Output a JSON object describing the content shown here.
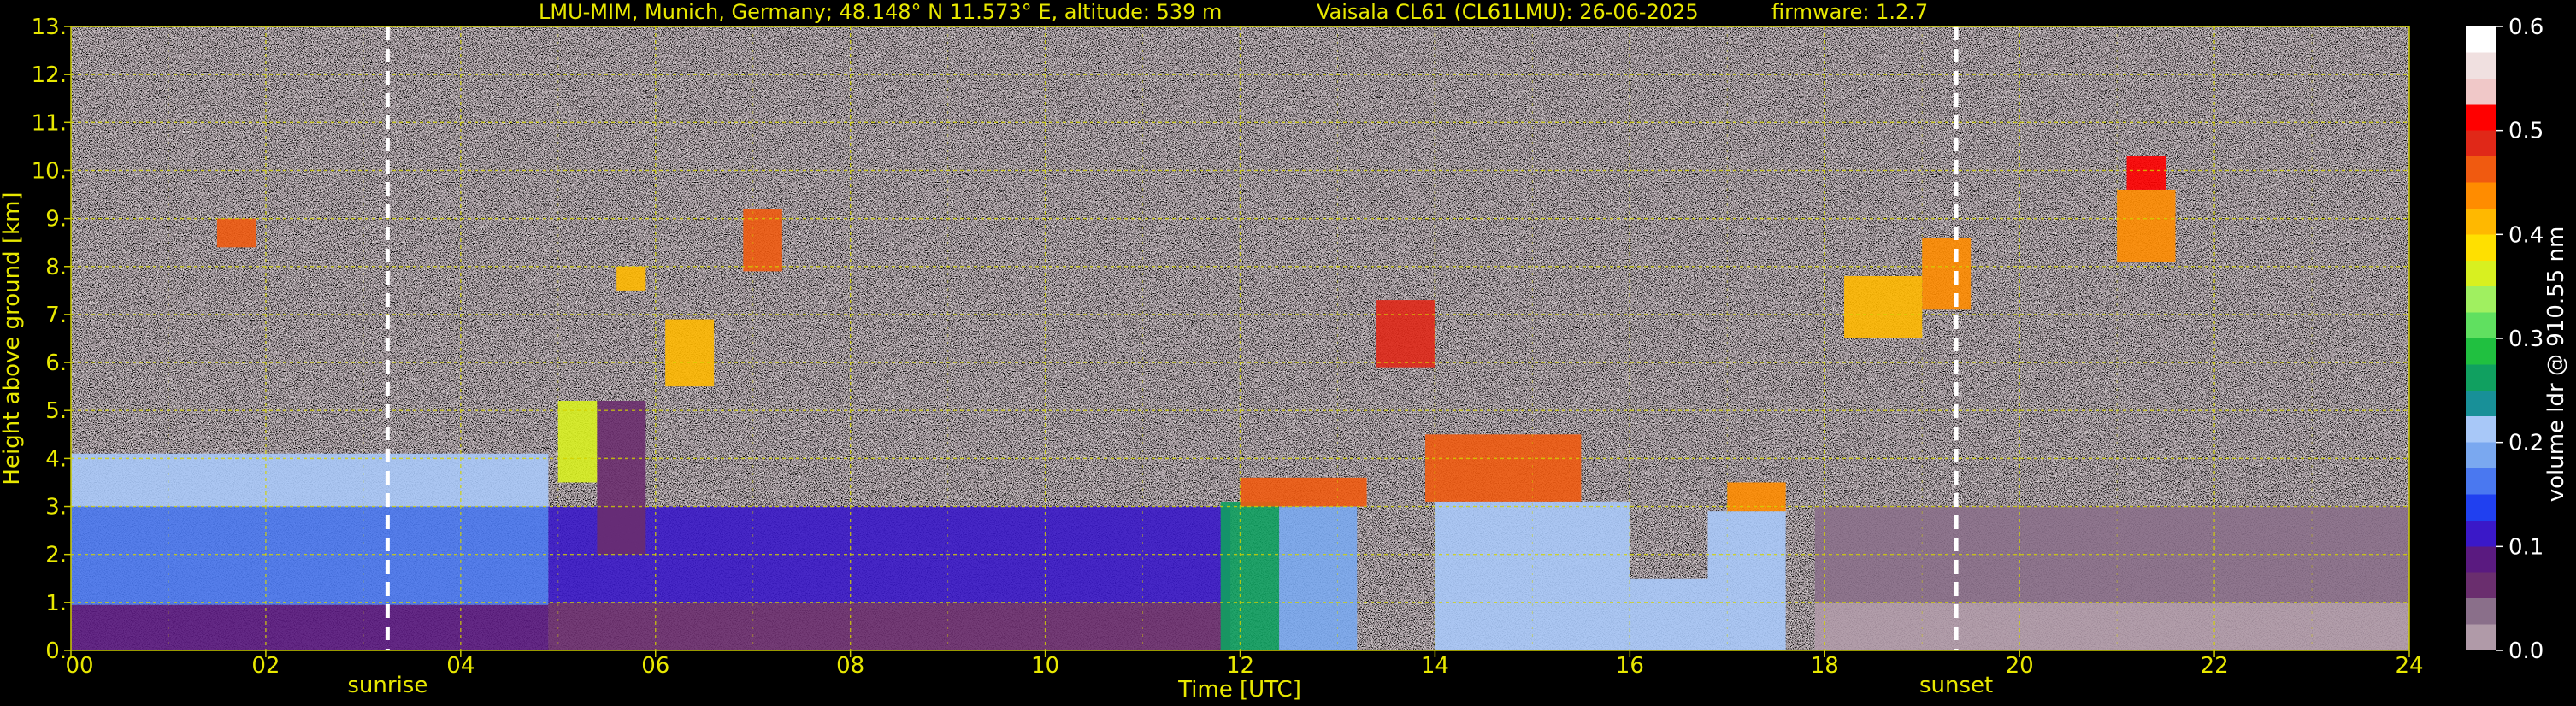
{
  "header": {
    "site": "LMU-MIM, Munich, Germany; 48.148° N 11.573° E, altitude: 539 m",
    "instrument": "Vaisala CL61 (CL61LMU): 26-06-2025",
    "firmware": "firmware: 1.2.7"
  },
  "chart_data": {
    "type": "heatmap",
    "title": "",
    "xlabel": "Time [UTC]",
    "ylabel": "Height above ground [km]",
    "xlim": [
      0,
      24
    ],
    "ylim": [
      0,
      13
    ],
    "x_ticks": [
      0,
      2,
      4,
      6,
      8,
      10,
      12,
      14,
      16,
      18,
      20,
      22,
      24
    ],
    "x_tick_labels": [
      "00",
      "02",
      "04",
      "06",
      "08",
      "10",
      "12",
      "14",
      "16",
      "18",
      "20",
      "22",
      "24"
    ],
    "y_ticks": [
      0,
      1,
      2,
      3,
      4,
      5,
      6,
      7,
      8,
      9,
      10,
      11,
      12,
      13
    ],
    "y_tick_labels": [
      "0.",
      "1.",
      "2.",
      "3.",
      "4.",
      "5.",
      "6.",
      "7.",
      "8.",
      "9.",
      "10.",
      "11.",
      "12.",
      "13."
    ],
    "grid": true,
    "colorbar": {
      "label": "volume ldr @ 910.55 nm",
      "range": [
        0,
        0.6
      ],
      "ticks": [
        0,
        0.1,
        0.2,
        0.3,
        0.4,
        0.5,
        0.6
      ],
      "tick_labels": [
        "0.0",
        "0.1",
        "0.2",
        "0.3",
        "0.4",
        "0.5",
        "0.6"
      ],
      "colors": [
        "#b09aa8",
        "#8a6f8a",
        "#6a2e6e",
        "#5a1a80",
        "#3a18c8",
        "#2040f0",
        "#4a78f0",
        "#7aa8f0",
        "#a8c8f8",
        "#189098",
        "#10a060",
        "#20c040",
        "#60e060",
        "#a0f060",
        "#d8f020",
        "#ffe000",
        "#ffb800",
        "#ff8c00",
        "#f05a10",
        "#e02818",
        "#ff0000",
        "#f0c8c8",
        "#f0e0e0",
        "#ffffff"
      ]
    },
    "events": [
      {
        "name": "sunrise",
        "time": 3.25
      },
      {
        "name": "sunset",
        "time": 19.35
      }
    ],
    "regions": [
      {
        "t0": 0,
        "t1": 4.9,
        "h0": 0,
        "h1": 0.95,
        "value": 0.09
      },
      {
        "t0": 0,
        "t1": 4.9,
        "h0": 0.95,
        "h1": 3.0,
        "value": 0.17
      },
      {
        "t0": 0,
        "t1": 4.9,
        "h0": 3.0,
        "h1": 4.1,
        "value": 0.2
      },
      {
        "t0": 4.9,
        "t1": 11.9,
        "h0": 0,
        "h1": 1.0,
        "value": 0.07
      },
      {
        "t0": 4.9,
        "t1": 11.9,
        "h0": 1.0,
        "h1": 3.0,
        "value": 0.1
      },
      {
        "t0": 5.0,
        "t1": 5.4,
        "h0": 3.5,
        "h1": 5.2,
        "value": 0.36
      },
      {
        "t0": 5.4,
        "t1": 5.9,
        "h0": 2.0,
        "h1": 5.2,
        "value": 0.05
      },
      {
        "t0": 5.6,
        "t1": 5.9,
        "h0": 7.5,
        "h1": 8.0,
        "value": 0.42
      },
      {
        "t0": 6.1,
        "t1": 6.6,
        "h0": 5.5,
        "h1": 6.9,
        "value": 0.4
      },
      {
        "t0": 6.9,
        "t1": 7.3,
        "h0": 7.9,
        "h1": 9.2,
        "value": 0.46
      },
      {
        "t0": 1.5,
        "t1": 1.9,
        "h0": 8.4,
        "h1": 9.0,
        "value": 0.47
      },
      {
        "t0": 11.8,
        "t1": 12.4,
        "h0": 0,
        "h1": 3.1,
        "value": 0.26
      },
      {
        "t0": 12.4,
        "t1": 13.2,
        "h0": 0,
        "h1": 3.0,
        "value": 0.18
      },
      {
        "t0": 12.0,
        "t1": 13.3,
        "h0": 3.0,
        "h1": 3.6,
        "value": 0.47
      },
      {
        "t0": 13.4,
        "t1": 14.0,
        "h0": 5.9,
        "h1": 7.3,
        "value": 0.49
      },
      {
        "t0": 13.9,
        "t1": 15.5,
        "h0": 3.1,
        "h1": 4.5,
        "value": 0.45
      },
      {
        "t0": 14.0,
        "t1": 16.0,
        "h0": 0,
        "h1": 3.1,
        "value": 0.2
      },
      {
        "t0": 16.0,
        "t1": 16.8,
        "h0": 0,
        "h1": 1.5,
        "value": 0.21
      },
      {
        "t0": 16.8,
        "t1": 17.6,
        "h0": 0,
        "h1": 2.9,
        "value": 0.22
      },
      {
        "t0": 17.0,
        "t1": 17.6,
        "h0": 2.9,
        "h1": 3.5,
        "value": 0.44
      },
      {
        "t0": 17.9,
        "t1": 24,
        "h0": 0,
        "h1": 1.0,
        "value": 0.02
      },
      {
        "t0": 17.9,
        "t1": 24,
        "h0": 1.0,
        "h1": 3.0,
        "value": 0.04
      },
      {
        "t0": 18.2,
        "t1": 19.0,
        "h0": 6.5,
        "h1": 7.8,
        "value": 0.41
      },
      {
        "t0": 19.0,
        "t1": 19.5,
        "h0": 7.1,
        "h1": 8.6,
        "value": 0.44
      },
      {
        "t0": 21.0,
        "t1": 21.6,
        "h0": 8.1,
        "h1": 9.6,
        "value": 0.43
      },
      {
        "t0": 21.1,
        "t1": 21.5,
        "h0": 9.6,
        "h1": 10.3,
        "value": 0.5
      }
    ]
  }
}
